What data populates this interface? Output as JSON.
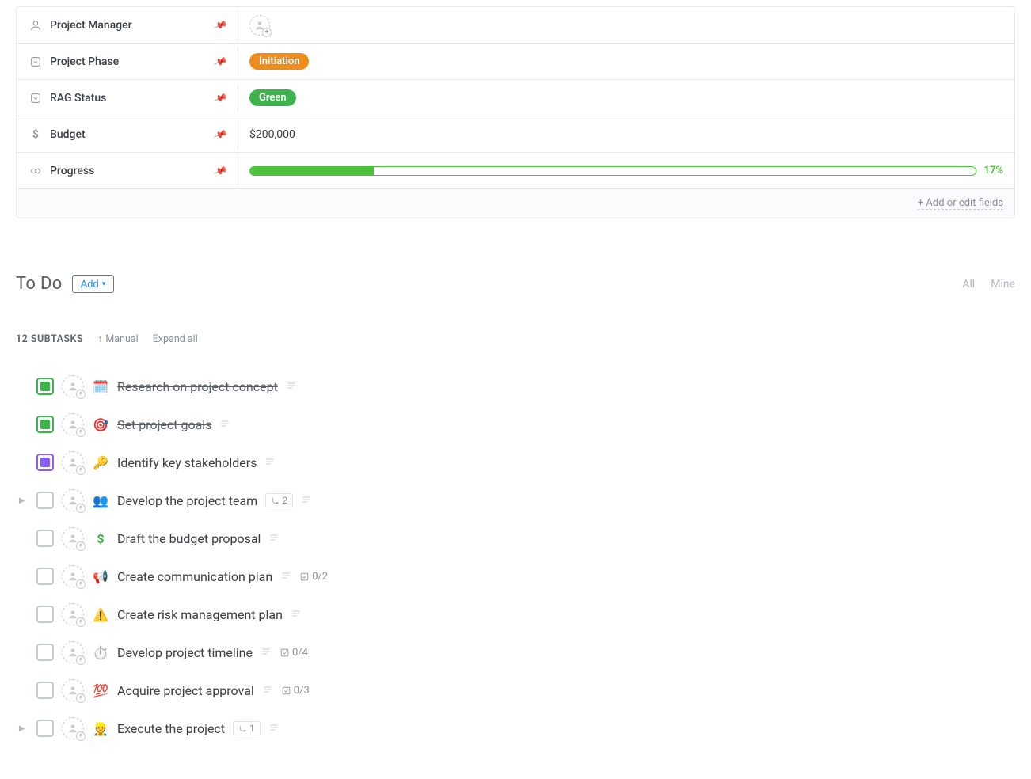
{
  "fields": {
    "project_manager": {
      "label": "Project Manager"
    },
    "project_phase": {
      "label": "Project Phase",
      "value": "Initiation",
      "color": "#f08c1a"
    },
    "rag_status": {
      "label": "RAG Status",
      "value": "Green",
      "color": "#3db34b"
    },
    "budget": {
      "label": "Budget",
      "value": "$200,000"
    },
    "progress": {
      "label": "Progress",
      "percent": 17,
      "percent_label": "17%"
    }
  },
  "fields_footer": "+ Add or edit fields",
  "todo": {
    "title": "To Do",
    "add_label": "Add",
    "filter_all": "All",
    "filter_mine": "Mine",
    "subtask_count_label": "12 SUBTASKS",
    "sort_label": "Manual",
    "expand_label": "Expand all"
  },
  "status_colors": {
    "done": "#3db34b",
    "progress": "#8b5cf6",
    "open": "#c6cad1"
  },
  "tasks": [
    {
      "title": "Research on project concept",
      "emoji": "🗓️",
      "status": "done",
      "has_desc": true
    },
    {
      "title": "Set project goals",
      "emoji": "🎯",
      "status": "done",
      "has_desc": true
    },
    {
      "title": "Identify key stakeholders",
      "emoji": "🔑",
      "status": "progress",
      "has_desc": true
    },
    {
      "title": "Develop the project team",
      "emoji": "👥",
      "status": "open",
      "has_desc": true,
      "subcount": 2,
      "expandable": true
    },
    {
      "title": "Draft the budget proposal",
      "emoji": "$",
      "status": "open",
      "has_desc": true,
      "emoji_color": "#3db34b",
      "indent": true
    },
    {
      "title": "Create communication plan",
      "emoji": "📢",
      "status": "open",
      "has_desc": true,
      "checklist": "0/2",
      "indent": true
    },
    {
      "title": "Create risk management plan",
      "emoji": "⚠️",
      "status": "open",
      "has_desc": true,
      "indent": true
    },
    {
      "title": "Develop project timeline",
      "emoji": "⏱️",
      "status": "open",
      "has_desc": true,
      "checklist": "0/4",
      "indent": true
    },
    {
      "title": "Acquire project approval",
      "emoji": "💯",
      "status": "open",
      "has_desc": true,
      "checklist": "0/3",
      "indent": true
    },
    {
      "title": "Execute the project",
      "emoji": "👷",
      "status": "open",
      "has_desc": true,
      "subcount": 1,
      "expandable": true
    }
  ]
}
